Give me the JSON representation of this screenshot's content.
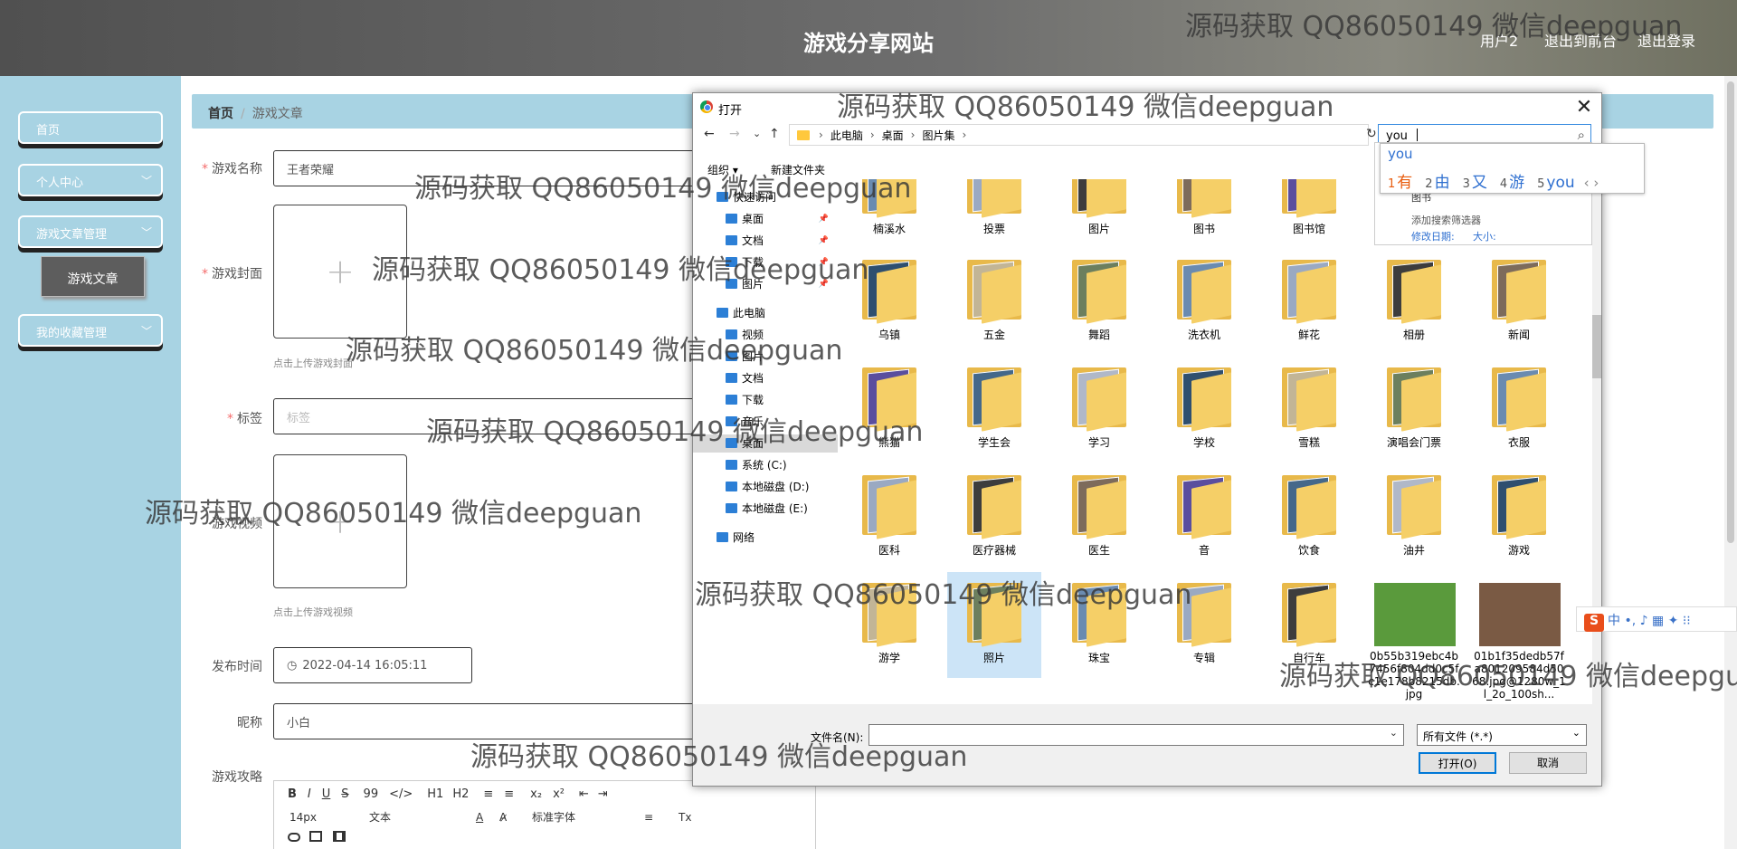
{
  "header": {
    "site_title": "游戏分享网站",
    "user": "用户2",
    "back_front": "退出到前台",
    "logout": "退出登录"
  },
  "sidebar": {
    "items": [
      {
        "label": "首页"
      },
      {
        "label": "个人中心"
      },
      {
        "label": "游戏文章管理"
      },
      {
        "label": "我的收藏管理"
      }
    ],
    "sub_item": "游戏文章",
    "chevron": "﹀"
  },
  "breadcrumb": {
    "home": "首页",
    "sep": "/",
    "current": "游戏文章"
  },
  "form": {
    "name_label": "游戏名称",
    "name_value": "王者荣耀",
    "cover_label": "游戏封面",
    "cover_hint": "点击上传游戏封面",
    "tag_label": "标签",
    "tag_placeholder": "标签",
    "video_label": "游戏视频",
    "video_hint": "点击上传游戏视频",
    "time_label": "发布时间",
    "time_value": "2022-04-14 16:05:11",
    "nick_label": "昵称",
    "nick_value": "小白",
    "guide_label": "游戏攻略",
    "required_mark": "*",
    "plus": "+",
    "clock": "◷"
  },
  "editor": {
    "row1": [
      "B",
      "I",
      "U",
      "S",
      "99",
      "</>",
      "H1",
      "H2",
      "≡",
      "≡",
      "x₂",
      "x²",
      "⇤",
      "⇥"
    ],
    "font_size": "14px",
    "text_style": "文本",
    "font_family": "标准字体",
    "row2_icons": [
      "A",
      "A̷",
      "≡",
      "Tx"
    ],
    "row3_icons": [
      "link-icon",
      "image-icon",
      "video-icon"
    ]
  },
  "dialog": {
    "title": "打开",
    "close": "✕",
    "nav": {
      "back": "←",
      "forward": "→",
      "down": "⌄",
      "up": "↑"
    },
    "breadcrumb": [
      "此电脑",
      "桌面",
      "图片集"
    ],
    "breadcrumb_sep": "›",
    "refresh": "↻",
    "search_value": "you",
    "search_icon": "⌕",
    "organize": "组织 ▾",
    "new_folder": "新建文件夹",
    "nav_pane": [
      {
        "label": "快速访问",
        "level": 0
      },
      {
        "label": "桌面",
        "level": 1,
        "pin": true
      },
      {
        "label": "文档",
        "level": 1,
        "pin": true
      },
      {
        "label": "下载",
        "level": 1,
        "pin": true
      },
      {
        "label": "图片",
        "level": 1,
        "pin": true
      },
      {
        "label": "此电脑",
        "level": 0
      },
      {
        "label": "视频",
        "level": 1
      },
      {
        "label": "图片",
        "level": 1
      },
      {
        "label": "文档",
        "level": 1
      },
      {
        "label": "下载",
        "level": 1
      },
      {
        "label": "音乐",
        "level": 1
      },
      {
        "label": "桌面",
        "level": 1,
        "selected": true
      },
      {
        "label": "系统 (C:)",
        "level": 1
      },
      {
        "label": "本地磁盘 (D:)",
        "level": 1
      },
      {
        "label": "本地磁盘 (E:)",
        "level": 1
      },
      {
        "label": "网络",
        "level": 0
      }
    ],
    "folders": [
      [
        "楠溪水",
        "投票",
        "图片",
        "图书",
        "图书馆",
        "",
        ""
      ],
      [
        "乌镇",
        "五金",
        "舞蹈",
        "洗衣机",
        "鲜花",
        "相册",
        "新闻"
      ],
      [
        "熊猫",
        "学生会",
        "学习",
        "学校",
        "雪糕",
        "演唱会门票",
        "衣服"
      ],
      [
        "医科",
        "医疗器械",
        "医生",
        "音",
        "饮食",
        "油井",
        "游戏"
      ],
      [
        "游学",
        "照片",
        "珠宝",
        "专辑",
        "自行车",
        "",
        ""
      ]
    ],
    "files": [
      {
        "name": "0b55b319ebc4b7456f804dd0c5fc1e178b8215db.jpg",
        "color": "#5a9a3c"
      },
      {
        "name": "01b1f35dedb57fa801209584d5068.jpg@1280w_1l_2o_100sh...",
        "color": "#7a5a44"
      }
    ],
    "filename_label": "文件名(N):",
    "filetype": "所有文件 (*.*)",
    "open_btn": "打开(O)",
    "cancel_btn": "取消"
  },
  "search_suggest": {
    "items": [
      "图书"
    ],
    "filter_title": "添加搜索筛选器",
    "filter_date": "修改日期:",
    "filter_size": "大小:"
  },
  "ime": {
    "composition": "you",
    "candidates": [
      {
        "n": "1",
        "c": "有"
      },
      {
        "n": "2",
        "c": "由"
      },
      {
        "n": "3",
        "c": "又"
      },
      {
        "n": "4",
        "c": "游"
      },
      {
        "n": "5",
        "c": "you"
      }
    ],
    "pager": "‹ ›",
    "bar_logo": "S",
    "bar_items": "中 •, ♪ ▦ ✦ ⁝⁝"
  },
  "watermark": "源码获取 QQ86050149 微信deepguan"
}
